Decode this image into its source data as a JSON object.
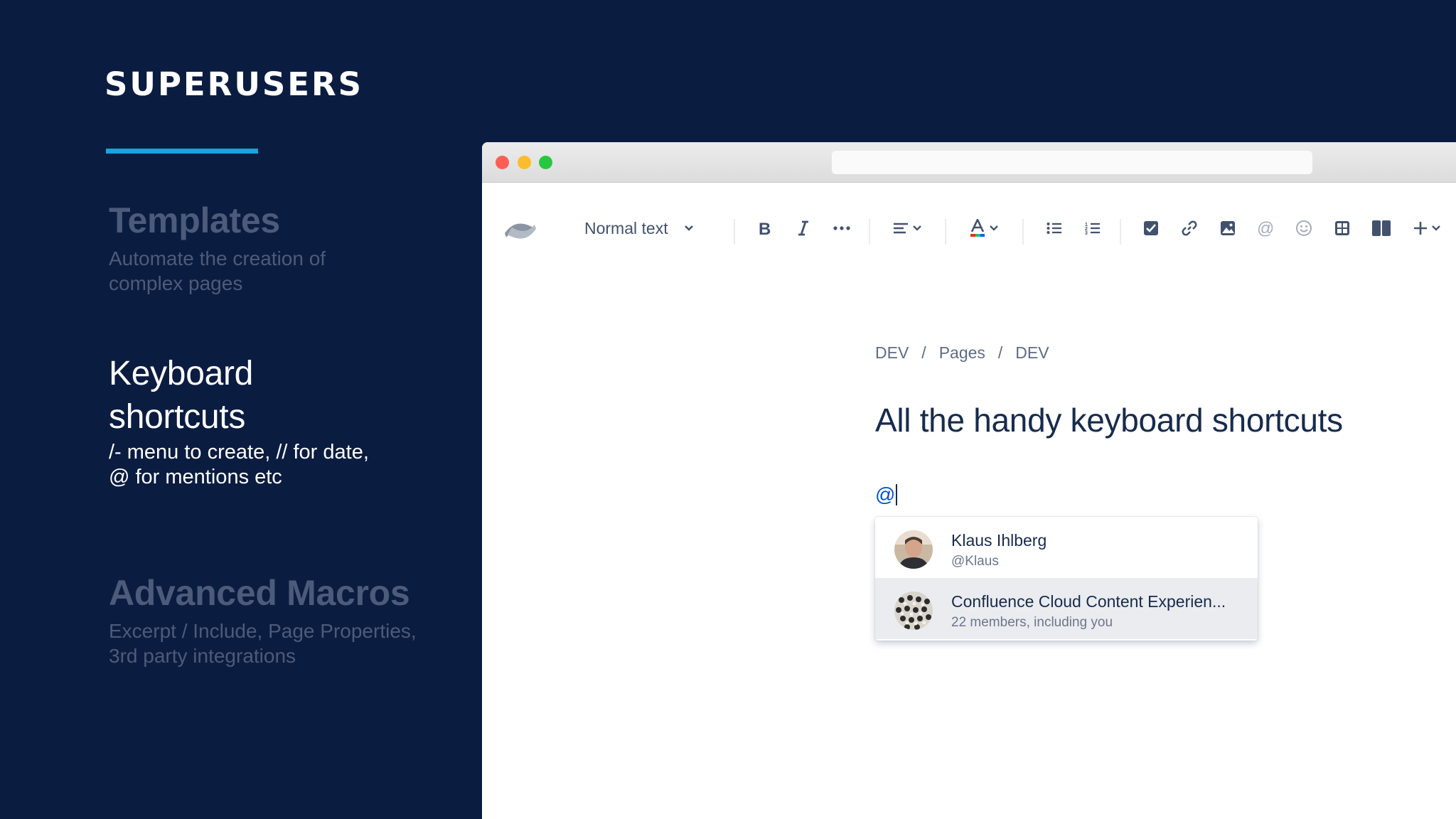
{
  "slide": {
    "brand": "SUPERUSERS",
    "accent_color": "#1aa3dd",
    "sections": [
      {
        "title": "Templates",
        "description_lines": [
          "Automate the creation of",
          "complex pages"
        ],
        "active": false
      },
      {
        "title_lines": [
          "Keyboard",
          "shortcuts"
        ],
        "description_lines": [
          "/- menu to create, // for date,",
          "@ for mentions etc"
        ],
        "active": true
      },
      {
        "title": "Advanced Macros",
        "description_lines": [
          "Excerpt / Include, Page Properties,",
          "3rd party integrations"
        ],
        "active": false
      }
    ]
  },
  "editor": {
    "toolbar": {
      "logo_icon": "confluence-logo-icon",
      "text_style": "Normal text",
      "icons": [
        "bold-icon",
        "italic-icon",
        "more-icon",
        "align-icon",
        "text-color-icon",
        "bullet-list-icon",
        "numbered-list-icon",
        "task-icon",
        "link-icon",
        "image-icon",
        "mention-icon",
        "emoji-icon",
        "table-icon",
        "layout-icon",
        "insert-icon"
      ]
    },
    "breadcrumb": [
      "DEV",
      "/",
      "Pages",
      "/",
      "DEV"
    ],
    "page_title": "All the handy keyboard shortcuts",
    "mention_input": "@",
    "mention_results": [
      {
        "name": "Klaus Ihlberg",
        "sub": "@Klaus",
        "selected": false
      },
      {
        "name": "Confluence Cloud Content Experien...",
        "sub": "22 members, including you",
        "selected": true
      }
    ]
  }
}
